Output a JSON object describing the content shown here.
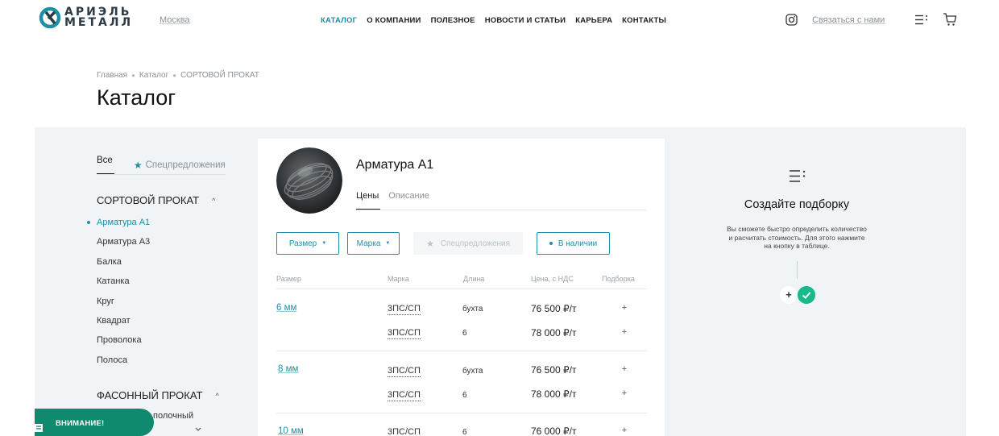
{
  "header": {
    "logo_line1": "АРИЭЛЬ",
    "logo_line2": "МЕТАЛЛ",
    "city": "Москва",
    "nav": [
      {
        "label": "КАТАЛОГ",
        "active": true
      },
      {
        "label": "О КОМПАНИИ",
        "active": false
      },
      {
        "label": "ПОЛЕЗНОЕ",
        "active": false
      },
      {
        "label": "НОВОСТИ И СТАТЬИ",
        "active": false
      },
      {
        "label": "КАРЬЕРА",
        "active": false
      },
      {
        "label": "КОНТАКТЫ",
        "active": false
      }
    ],
    "contact_link": "Связаться с нами",
    "icons": [
      "instagram-icon",
      "list-icon",
      "cart-icon"
    ]
  },
  "breadcrumb": [
    "Главная",
    "Каталог",
    "СОРТОВОЙ ПРОКАТ"
  ],
  "page_title": "Каталог",
  "sidebar": {
    "tab_all": "Все",
    "tab_offers": "Спецпредложения",
    "category1": "СОРТОВОЙ ПРОКАТ",
    "items": [
      "Арматура А1",
      "Арматура А3",
      "Балка",
      "Катанка",
      "Круг",
      "Квадрат",
      "Проволока",
      "Полоса"
    ],
    "active_item": "Арматура А1",
    "category2": "ФАСОННЫЙ ПРОКАТ",
    "sub_item_partial": "полочный"
  },
  "attention": "ВНИМАНИЕ!",
  "product": {
    "name": "Арматура А1",
    "tabs": [
      "Цены",
      "Описание"
    ],
    "filters": {
      "size": "Размер",
      "mark": "Марка",
      "offers": "Спецпредложения",
      "stock": "В наличии"
    },
    "columns": [
      "Размер",
      "Марка",
      "Длина",
      "Цена, с НДС",
      "Подборка"
    ],
    "rows": [
      {
        "size": "6 мм",
        "mark": "3ПС/СП",
        "length": "бухта",
        "price": "76 500 ₽/т"
      },
      {
        "size": "",
        "mark": "3ПС/СП",
        "length": "6",
        "price": "78 000 ₽/т"
      },
      {
        "size": "8 мм",
        "mark": "3ПС/СП",
        "length": "бухта",
        "price": "76 500 ₽/т"
      },
      {
        "size": "",
        "mark": "3ПС/СП",
        "length": "6",
        "price": "78 000 ₽/т"
      },
      {
        "size": "10 мм",
        "mark": "3ПС/СП",
        "length": "6",
        "price": "76 000 ₽/т"
      }
    ],
    "add_symbol": "+"
  },
  "selection": {
    "title": "Создайте подборку",
    "description_line1": "Вы сможете быстро определить количество",
    "description_line2": "и расчитать стоимость. Для этого нажмите",
    "description_line3": "на кнопку в таблице.",
    "plus": "+"
  },
  "colors": {
    "accent": "#1f8fa8",
    "attention_bg": "#0f8a6e",
    "check_bg": "#19b98e",
    "panel_bg": "#f1f4f6"
  }
}
